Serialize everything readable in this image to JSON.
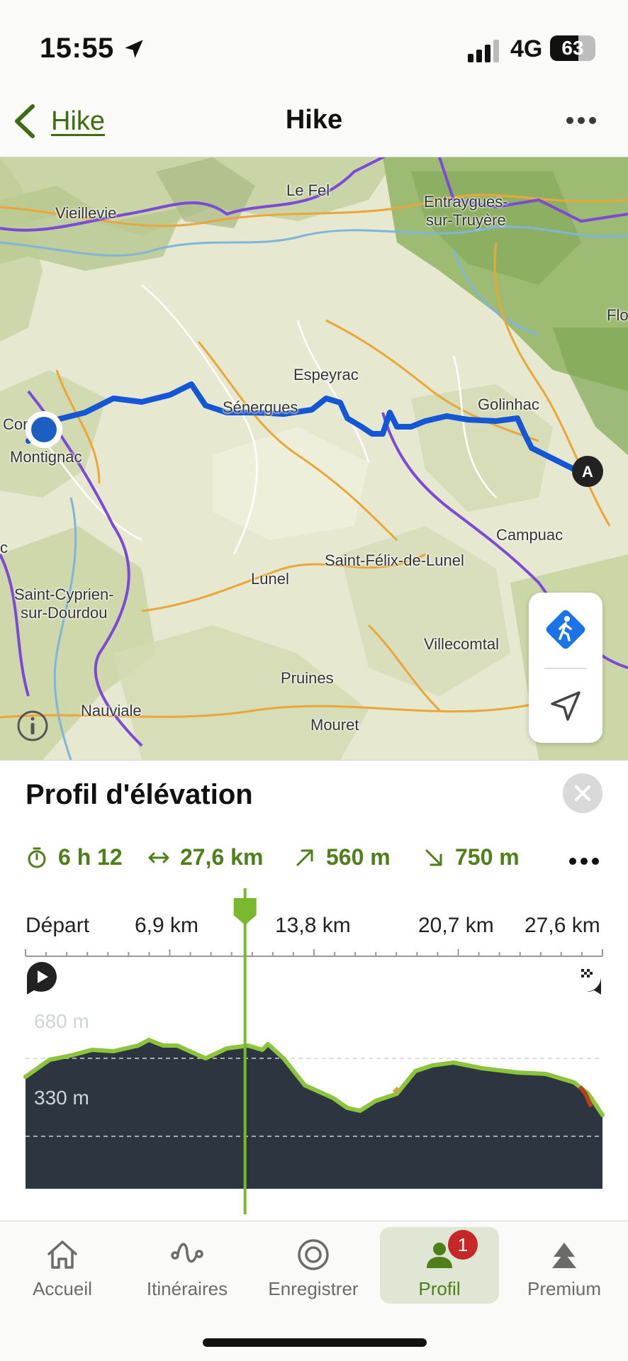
{
  "status_bar": {
    "time": "15:55",
    "network": "4G",
    "battery": "63"
  },
  "header": {
    "back_label": "Hike",
    "title": "Hike",
    "more_icon": "ellipsis-icon"
  },
  "map": {
    "places": [
      {
        "id": "le-fel",
        "name": "Le Fel"
      },
      {
        "id": "vieillevie",
        "name": "Vieillevie"
      },
      {
        "id": "entraygues",
        "line1": "Entraygues-",
        "line2": "sur-Truyère"
      },
      {
        "id": "flo",
        "name": "Flo"
      },
      {
        "id": "espeyrac",
        "name": "Espeyrac"
      },
      {
        "id": "senergues",
        "name": "Sénergues"
      },
      {
        "id": "golinhac",
        "name": "Golinhac"
      },
      {
        "id": "conques",
        "name": "Con..s"
      },
      {
        "id": "montignac",
        "name": "Montignac"
      },
      {
        "id": "c",
        "name": "c"
      },
      {
        "id": "campuac",
        "name": "Campuac"
      },
      {
        "id": "saint-felix",
        "name": "Saint-Félix-de-Lunel"
      },
      {
        "id": "lunel",
        "name": "Lunel"
      },
      {
        "id": "saint-cyprien",
        "line1": "Saint-Cyprien-",
        "line2": "sur-Dourdou"
      },
      {
        "id": "villecomtal",
        "name": "Villecomtal"
      },
      {
        "id": "pruines",
        "name": "Pruines"
      },
      {
        "id": "nauviale",
        "name": "Nauviale"
      },
      {
        "id": "mouret",
        "name": "Mouret"
      }
    ],
    "end_marker_label": "A",
    "route_color": "#1457d6",
    "border_color": "#7b4bd8"
  },
  "elevation": {
    "title": "Profil d'élévation",
    "stats": {
      "duration": "6 h 12",
      "distance": "27,6 km",
      "ascent": "560 m",
      "descent": "750 m"
    },
    "axis_labels": [
      "Départ",
      "6,9 km",
      "13,8 km",
      "20,7 km",
      "27,6 km"
    ],
    "y_labels": [
      "680 m",
      "330 m"
    ],
    "cursor_position_km": 10.5,
    "fill_color": "#2d3540",
    "line_color": "#8cc43c"
  },
  "tabbar": {
    "tabs": [
      {
        "label": "Accueil"
      },
      {
        "label": "Itinéraires"
      },
      {
        "label": "Enregistrer"
      },
      {
        "label": "Profil",
        "badge": "1"
      },
      {
        "label": "Premium"
      }
    ],
    "active_tab": "Profil"
  }
}
